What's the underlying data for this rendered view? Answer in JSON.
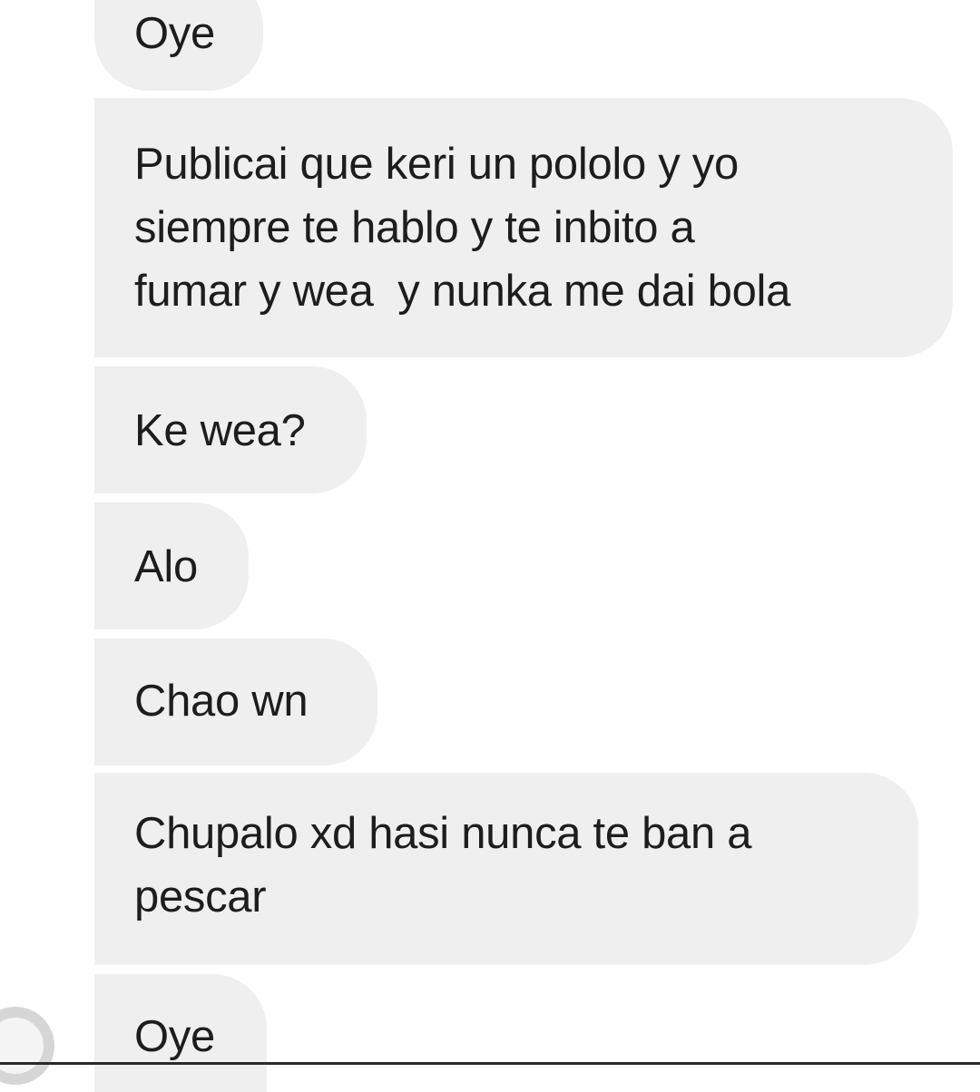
{
  "messages": [
    {
      "text": "Oye"
    },
    {
      "text": "Publicai que keri un pololo y yo\nsiempre te hablo y te inbito a\nfumar y wea  y nunka me dai bola"
    },
    {
      "text": "Ke wea?"
    },
    {
      "text": "Alo"
    },
    {
      "text": "Chao wn"
    },
    {
      "text": "Chupalo xd hasi nunca te ban a\npescar"
    },
    {
      "text": "Oye"
    }
  ]
}
